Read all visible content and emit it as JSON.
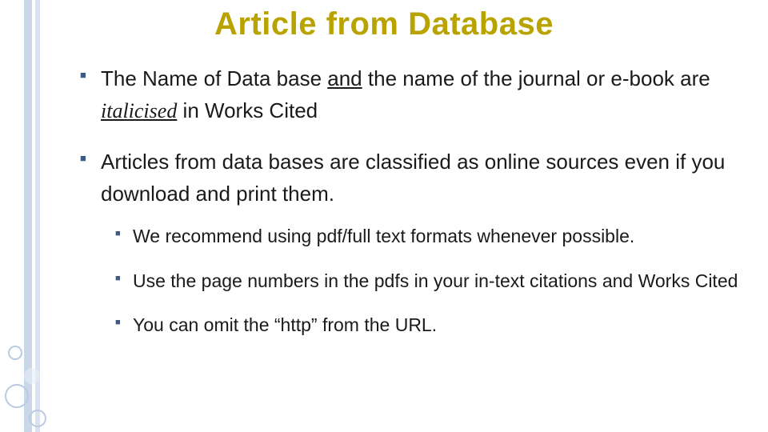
{
  "title": "Article from Database",
  "bullets": {
    "b1": {
      "seg1": "The Name of Data base ",
      "and": "and",
      "seg2": " the name of the journal or e-book are ",
      "ital": "italicised",
      "seg3": " in Works Cited"
    },
    "b2": {
      "text": "Articles from data bases are classified as online sources even if you download and print them.",
      "subs": {
        "s1": "We recommend using pdf/full text formats whenever possible.",
        "s2": "Use the page numbers in the pdfs in your in-text citations and Works Cited",
        "s3": "You can omit the “http” from the URL."
      }
    }
  }
}
